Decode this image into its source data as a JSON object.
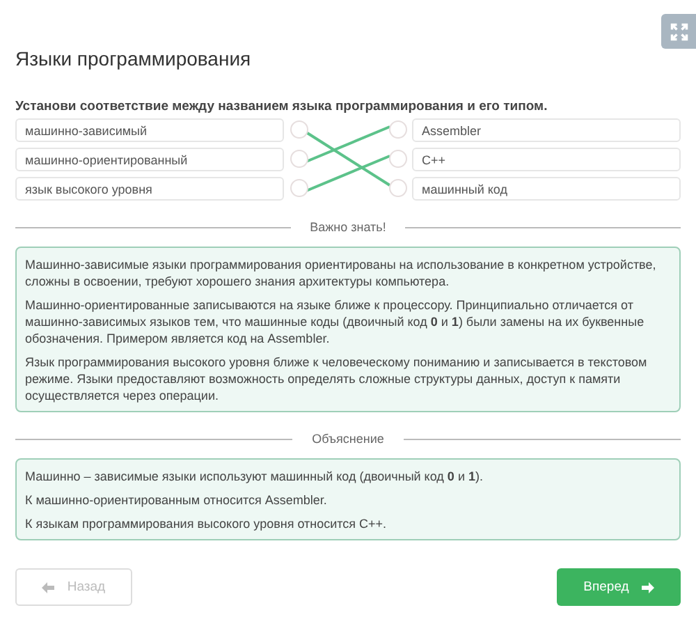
{
  "title": "Языки программирования",
  "task": {
    "instruction": "Установи соответствие между названием языка программирования и его типом.",
    "left": [
      {
        "text": "машинно-зависимый",
        "links": [
          false,
          false,
          true
        ]
      },
      {
        "text": "машинно-ориентированный",
        "links": [
          true,
          false,
          false
        ]
      },
      {
        "text": "язык высокого уровня",
        "links": [
          false,
          true,
          false
        ]
      }
    ],
    "right": [
      {
        "text": "Assembler"
      },
      {
        "text": "C++"
      },
      {
        "text": "машинный код"
      }
    ]
  },
  "sections": [
    {
      "heading": "Важно знать!",
      "paragraphs": [
        "Машинно-зависимые языки программирования ориентированы на использование в конкретном устройстве, сложны в освоении, требуют хорошего знания архитектуры компьютера.",
        "Машинно-ориентированные записываются на языке ближе к процессору. Принципиально отличается от машинно-зависимых языков тем, что машинные коды (двоичный код **0** и **1**) были замены на их буквенные обозначения. Примером является код на Assembler.",
        "Язык программирования высокого уровня ближе к человеческому пониманию и записывается в текстовом режиме. Языки предоставляют возможность определять сложные структуры данных, доступ к памяти осуществляется через операции."
      ]
    },
    {
      "heading": "Объяснение",
      "paragraphs": [
        "Машинно – зависимые языки используют машинный код (двоичный код **0** и **1**).",
        "К машинно-ориентированным относится Assembler.",
        "К языкам программирования высокого уровня относится C++."
      ]
    }
  ],
  "buttons": {
    "back": {
      "label": "Назад",
      "disabled": true
    },
    "next": {
      "label": "Вперед",
      "disabled": false
    }
  }
}
